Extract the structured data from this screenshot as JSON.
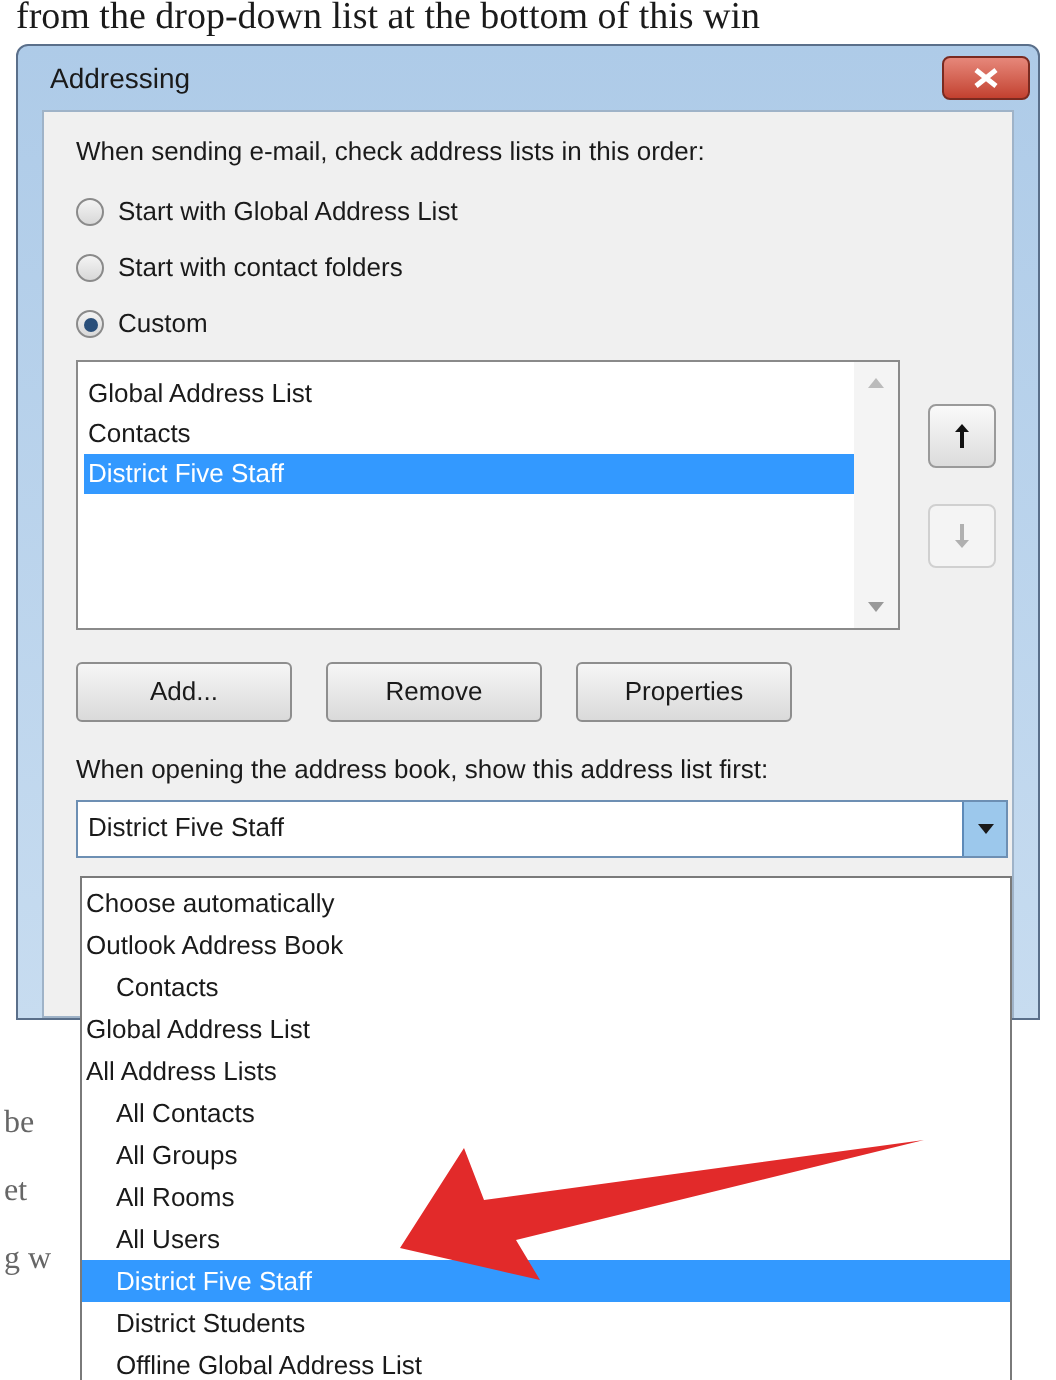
{
  "page_text": "from the drop-down list at the bottom of this win",
  "dialog": {
    "title": "Addressing",
    "order_label": "When sending e-mail, check address lists in this order:",
    "radios": [
      {
        "label": "Start with Global Address List",
        "selected": false
      },
      {
        "label": "Start with contact folders",
        "selected": false
      },
      {
        "label": "Custom",
        "selected": true
      }
    ],
    "lists": [
      {
        "label": "Global Address List",
        "selected": false
      },
      {
        "label": "Contacts",
        "selected": false
      },
      {
        "label": "District Five Staff",
        "selected": true
      }
    ],
    "move_buttons": [
      {
        "kind": "up",
        "disabled": false
      },
      {
        "kind": "down",
        "disabled": true
      }
    ],
    "buttons": [
      "Add...",
      "Remove",
      "Properties"
    ],
    "first_label": "When opening the address book, show this address list first:",
    "combo": {
      "value": "District Five Staff",
      "expanded": true
    }
  },
  "dropdown_items": [
    {
      "label": "Choose automatically",
      "selected": false
    },
    {
      "label": "Outlook Address Book",
      "selected": false,
      "children": [
        {
          "label": "Contacts",
          "selected": false
        }
      ]
    },
    {
      "label": "Global Address List",
      "selected": false
    },
    {
      "label": "All Address Lists",
      "selected": false,
      "children": [
        {
          "label": "All Contacts",
          "selected": false
        },
        {
          "label": "All Groups",
          "selected": false
        },
        {
          "label": "All Rooms",
          "selected": false
        },
        {
          "label": "All Users",
          "selected": false
        },
        {
          "label": "District Five Staff",
          "selected": true
        },
        {
          "label": "District Students",
          "selected": false
        },
        {
          "label": "Offline Global Address List",
          "selected": false
        }
      ]
    }
  ],
  "background_fragments": [
    "be",
    "et",
    "g w"
  ]
}
